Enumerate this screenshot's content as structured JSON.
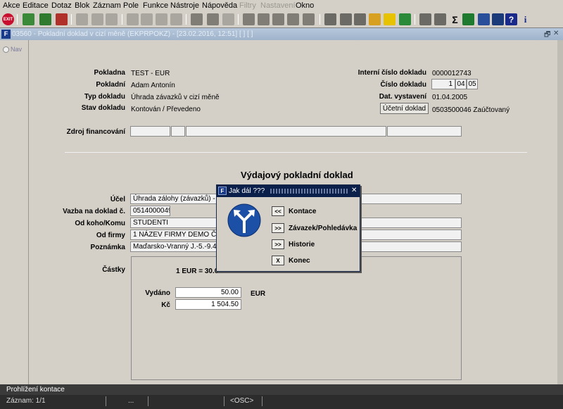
{
  "menu": [
    {
      "label": "Akce",
      "disabled": false
    },
    {
      "label": "Editace",
      "disabled": false
    },
    {
      "label": "Dotaz",
      "disabled": false
    },
    {
      "label": "Blok",
      "disabled": false
    },
    {
      "label": "Záznam",
      "disabled": false
    },
    {
      "label": "Pole",
      "disabled": false
    },
    {
      "label": "Funkce",
      "disabled": false
    },
    {
      "label": "Nástroje",
      "disabled": false
    },
    {
      "label": "Nápověda",
      "disabled": false
    },
    {
      "label": "Filtry",
      "disabled": true
    },
    {
      "label": "Nastavení",
      "disabled": true
    },
    {
      "label": "Okno",
      "disabled": false
    }
  ],
  "toolbar": {
    "exit_label": "EXIT",
    "sigma_label": "Σ",
    "help_label": "?",
    "info_label": "i"
  },
  "window": {
    "title": "03560 - Pokladní doklad v cizí měně (EKPRPOKZ) - [23.02.2016, 12:51]  [ ] [ ]",
    "nav_label": "Nav",
    "restore_label": "🗗",
    "close_label": "✕"
  },
  "form": {
    "pokladna_label": "Pokladna",
    "pokladna_value": "TEST - EUR",
    "pokladni_label": "Pokladní",
    "pokladni_value": "Adam Antonín",
    "typ_label": "Typ dokladu",
    "typ_value": "Úhrada závazků v cizí měně",
    "stav_label": "Stav dokladu",
    "stav_value": "Kontován / Převedeno",
    "interni_label": "Interní číslo dokladu",
    "interni_value": "0000012743",
    "cislo_label": "Číslo dokladu",
    "cislo_part1": "1",
    "cislo_part2": "04",
    "cislo_part3": "05",
    "datum_label": "Dat. vystavení",
    "datum_value": "01.04.2005",
    "ucetni_button": "Účetní doklad",
    "ucetni_value": "0503500046 Zaúčtovaný",
    "zdroj_label": "Zdroj financování",
    "section_title": "Výdajový pokladní doklad",
    "ucel_label": "Účel",
    "ucel_value": "Úhrada zálohy (závazků) - cizí",
    "vazba_label": "Vazba na doklad č.",
    "vazba_value": "0514000049",
    "odkoho_label": "Od koho/Komu",
    "odkoho_value": "STUDENTI",
    "firma_label": "Od firmy",
    "firma_value": "1 NÁZEV FIRMY DEMO Část fir",
    "poznamka_label": "Poznámka",
    "poznamka_value": "Maďarsko-Vranný J.-5.-9.4.05,k",
    "castky_label": "Částky",
    "kurz_text": "1 EUR = 30.09 CZK",
    "vydano_label": "Vydáno",
    "vydano_value": "50.00",
    "vydano_currency": "EUR",
    "kc_label": "Kč",
    "kc_value": "1 504.50"
  },
  "dialog": {
    "title": "Jak dál ???",
    "close_label": "✕",
    "buttons": [
      {
        "symbol": "<<",
        "label": "Kontace"
      },
      {
        "symbol": ">>",
        "label": "Závazek/Pohledávka"
      },
      {
        "symbol": ">>",
        "label": "Historie"
      },
      {
        "symbol": "X",
        "label": "Konec"
      }
    ]
  },
  "status": {
    "message": "Prohlížení kontace",
    "record": "Záznam: 1/1",
    "seg2": "...",
    "osc": "<OSC>"
  }
}
